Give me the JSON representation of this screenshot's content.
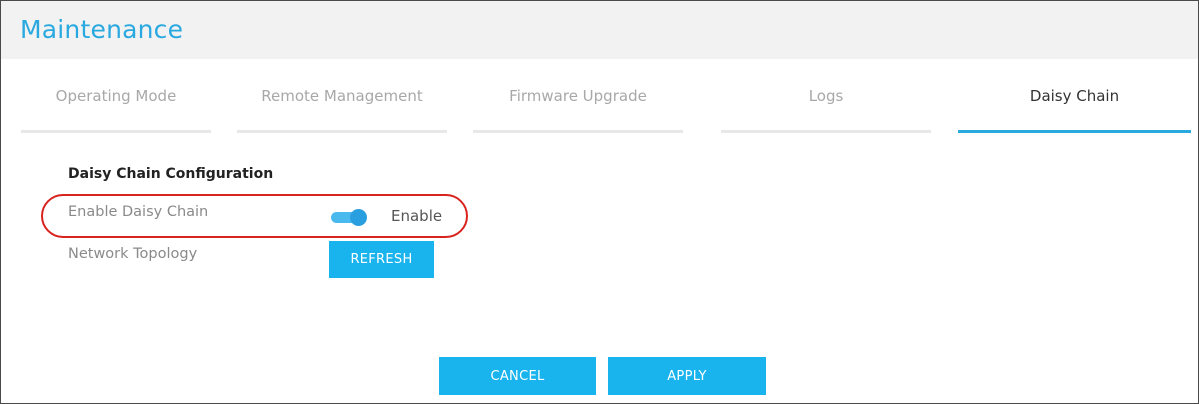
{
  "header": {
    "title": "Maintenance"
  },
  "tabs": [
    {
      "label": "Operating Mode",
      "active": false
    },
    {
      "label": "Remote Management",
      "active": false
    },
    {
      "label": "Firmware Upgrade",
      "active": false
    },
    {
      "label": "Logs",
      "active": false
    },
    {
      "label": "Daisy Chain",
      "active": true
    }
  ],
  "section": {
    "title": "Daisy Chain Configuration",
    "enable_daisy_chain": {
      "label": "Enable Daisy Chain",
      "state": "on",
      "state_text": "Enable"
    },
    "network_topology": {
      "label": "Network Topology",
      "button_label": "REFRESH"
    }
  },
  "actions": {
    "cancel_label": "CANCEL",
    "apply_label": "APPLY"
  },
  "colors": {
    "accent": "#2aa9e0",
    "button": "#19b3ee",
    "highlight": "#d9231f",
    "header_bg": "#f2f2f2"
  },
  "icons": {
    "toggle": "toggle-switch-icon"
  }
}
